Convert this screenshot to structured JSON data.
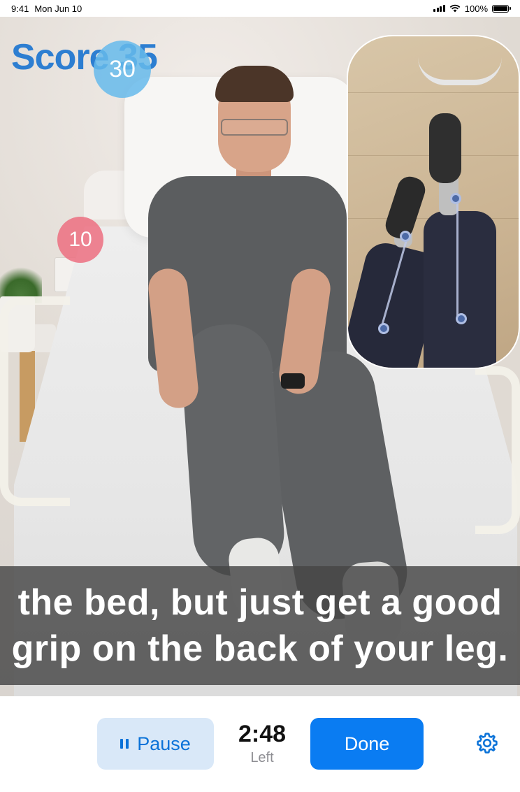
{
  "status_bar": {
    "time": "9:41",
    "date": "Mon Jun 10",
    "battery": "100%"
  },
  "score": {
    "label": "Score 35",
    "bubble_blue": "30",
    "bubble_red": "10"
  },
  "caption": {
    "line1": "the bed, but just get a good",
    "line2": "grip on the back of your leg."
  },
  "controls": {
    "pause_label": "Pause",
    "timer": "2:48",
    "timer_label": "Left",
    "done_label": "Done"
  },
  "icons": {
    "pause": "pause-icon",
    "settings": "gear-icon",
    "signal": "signal-icon",
    "wifi": "wifi-icon",
    "battery": "battery-icon"
  },
  "colors": {
    "accent": "#0a7cf2",
    "pause_bg": "#d9e8f8",
    "score_text": "#2d7ed1",
    "bubble_blue": "#66baeb",
    "bubble_red": "#ec6e80"
  }
}
